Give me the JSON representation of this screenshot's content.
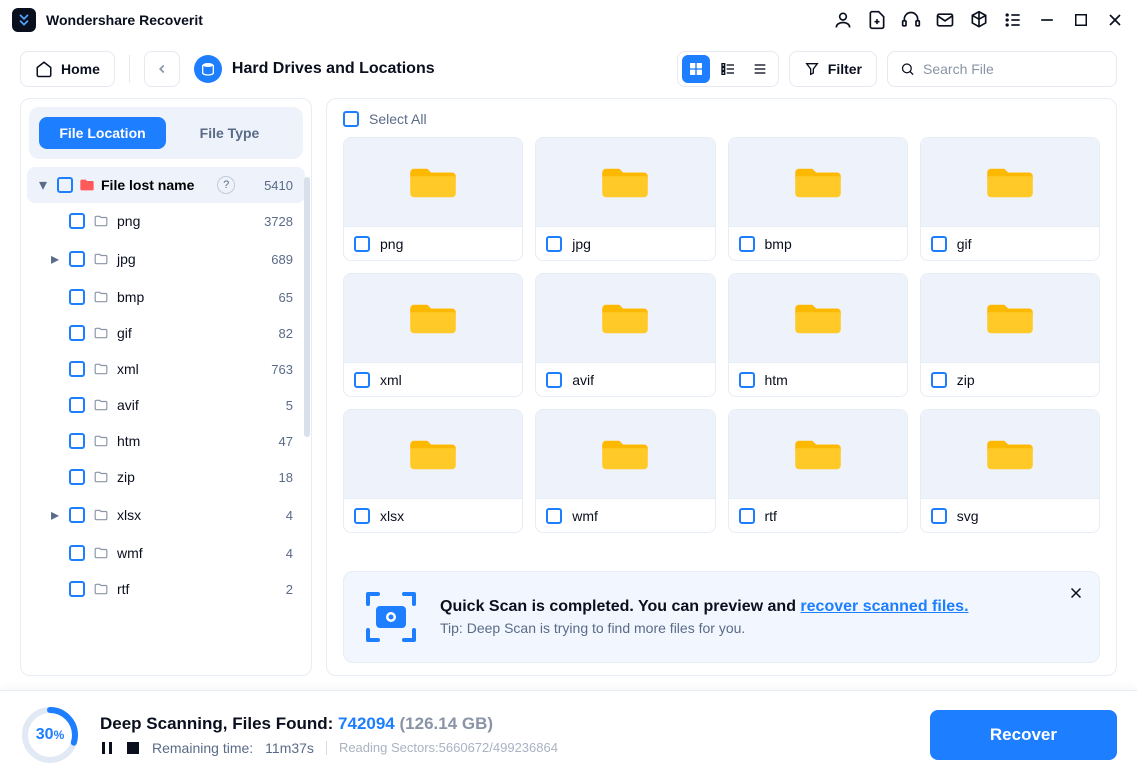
{
  "app": {
    "title": "Wondershare Recoverit"
  },
  "toolbar": {
    "home_label": "Home",
    "location_label": "Hard Drives and Locations",
    "filter_label": "Filter",
    "search_placeholder": "Search File"
  },
  "sidebar": {
    "tabs": {
      "file_location": "File Location",
      "file_type": "File Type"
    },
    "root": {
      "label": "File lost name",
      "count": "5410"
    },
    "items": [
      {
        "name": "png",
        "count": "3728",
        "expandable": false
      },
      {
        "name": "jpg",
        "count": "689",
        "expandable": true
      },
      {
        "name": "bmp",
        "count": "65",
        "expandable": false
      },
      {
        "name": "gif",
        "count": "82",
        "expandable": false
      },
      {
        "name": "xml",
        "count": "763",
        "expandable": false
      },
      {
        "name": "avif",
        "count": "5",
        "expandable": false
      },
      {
        "name": "htm",
        "count": "47",
        "expandable": false
      },
      {
        "name": "zip",
        "count": "18",
        "expandable": false
      },
      {
        "name": "xlsx",
        "count": "4",
        "expandable": true
      },
      {
        "name": "wmf",
        "count": "4",
        "expandable": false
      },
      {
        "name": "rtf",
        "count": "2",
        "expandable": false
      }
    ]
  },
  "content": {
    "select_all": "Select All",
    "folders": [
      {
        "name": "png"
      },
      {
        "name": "jpg"
      },
      {
        "name": "bmp"
      },
      {
        "name": "gif"
      },
      {
        "name": "xml"
      },
      {
        "name": "avif"
      },
      {
        "name": "htm"
      },
      {
        "name": "zip"
      },
      {
        "name": "xlsx"
      },
      {
        "name": "wmf"
      },
      {
        "name": "rtf"
      },
      {
        "name": "svg"
      }
    ]
  },
  "notice": {
    "title_prefix": "Quick Scan is completed. You can preview and ",
    "link": "recover scanned files.",
    "tip": "Tip: Deep Scan is trying to find more files for you."
  },
  "footer": {
    "percent": "30",
    "percent_sign": "%",
    "status_prefix": "Deep Scanning, Files Found: ",
    "count": "742094",
    "size": "(126.14 GB)",
    "remaining_label": "Remaining time:",
    "remaining_value": "11m37s",
    "sectors": "Reading Sectors:5660672/499236864",
    "recover_label": "Recover"
  }
}
